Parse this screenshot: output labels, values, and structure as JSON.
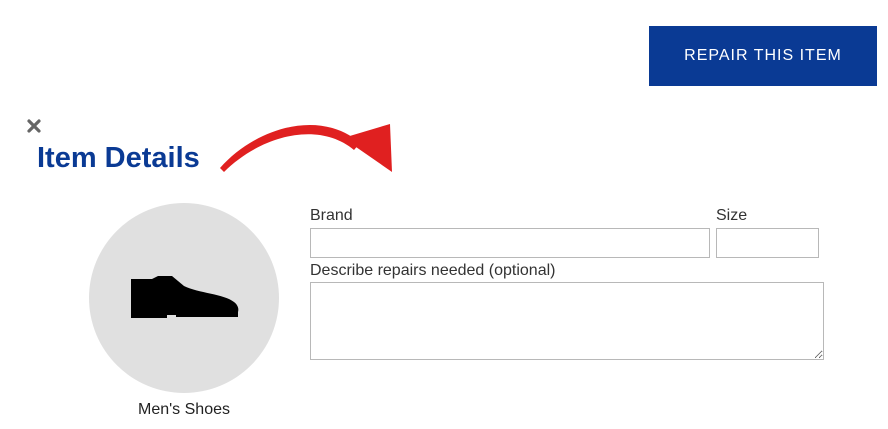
{
  "header": {
    "repair_button_label": "REPAIR THIS ITEM"
  },
  "panel": {
    "title": "Item Details",
    "item": {
      "label": "Men's Shoes",
      "icon": "shoe-icon"
    },
    "form": {
      "brand_label": "Brand",
      "brand_value": "",
      "size_label": "Size",
      "size_value": "",
      "repairs_label": "Describe repairs needed (optional)",
      "repairs_value": ""
    }
  },
  "colors": {
    "accent": "#0a3a94",
    "arrow": "#e02020",
    "circle": "#e0e0e0"
  }
}
